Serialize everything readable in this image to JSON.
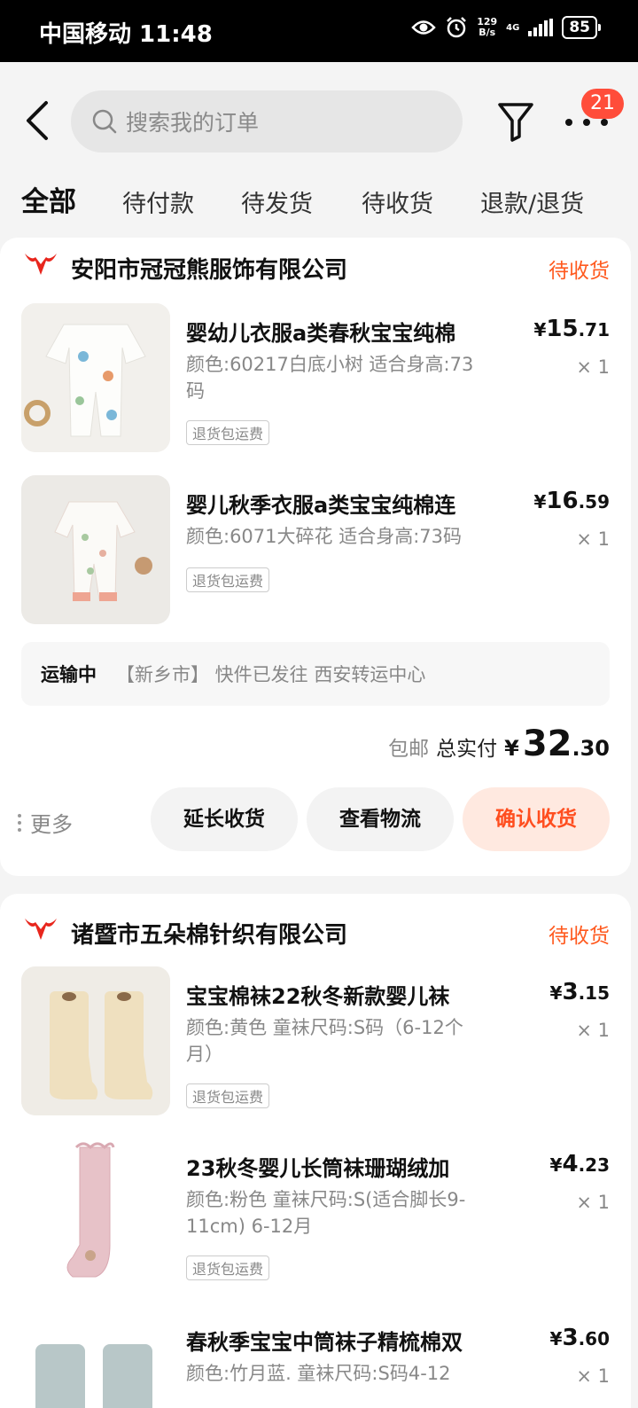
{
  "status_bar": {
    "carrier_time": "中国移动 11:48",
    "net_speed_top": "129",
    "net_speed_bottom": "B/s",
    "signal": "4G",
    "battery": "85"
  },
  "header": {
    "search_placeholder": "搜索我的订单",
    "badge": "21",
    "tabs": [
      "全部",
      "待付款",
      "待发货",
      "待收货",
      "退款/退货"
    ]
  },
  "orders": [
    {
      "shop": "安阳市冠冠熊服饰有限公司",
      "status": "待收货",
      "items": [
        {
          "title": "婴幼儿衣服a类春秋宝宝纯棉",
          "spec": "颜色:60217白底小树 适合身高:73码",
          "tag": "退货包运费",
          "price_symbol": "¥",
          "price_int": "15",
          "price_dec": ".71",
          "qty": "× 1"
        },
        {
          "title": "婴儿秋季衣服a类宝宝纯棉连",
          "spec": "颜色:6071大碎花 适合身高:73码",
          "tag": "退货包运费",
          "price_symbol": "¥",
          "price_int": "16",
          "price_dec": ".59",
          "qty": "× 1"
        }
      ],
      "logistics": {
        "status": "运输中",
        "text": "【新乡市】 快件已发往 西安转运中心"
      },
      "total": {
        "shipping": "包邮",
        "label": "总实付",
        "symbol": "¥",
        "int": "32",
        "dec": ".30"
      },
      "actions": {
        "more": "更多",
        "extend": "延长收货",
        "track": "查看物流",
        "confirm": "确认收货"
      }
    },
    {
      "shop": "诸暨市五朵棉针织有限公司",
      "status": "待收货",
      "items": [
        {
          "title": "宝宝棉袜22秋冬新款婴儿袜",
          "spec": "颜色:黄色 童袜尺码:S码（6-12个月）",
          "tag": "退货包运费",
          "price_symbol": "¥",
          "price_int": "3",
          "price_dec": ".15",
          "qty": "× 1"
        },
        {
          "title": "23秋冬婴儿长筒袜珊瑚绒加",
          "spec": "颜色:粉色 童袜尺码:S(适合脚长9-11cm) 6-12月",
          "tag": "退货包运费",
          "price_symbol": "¥",
          "price_int": "4",
          "price_dec": ".23",
          "qty": "× 1"
        },
        {
          "title": "春秋季宝宝中筒袜子精梳棉双",
          "spec": "颜色:竹月蓝. 童袜尺码:S码4-12",
          "price_symbol": "¥",
          "price_int": "3",
          "price_dec": ".60",
          "qty": "× 1"
        }
      ]
    }
  ]
}
